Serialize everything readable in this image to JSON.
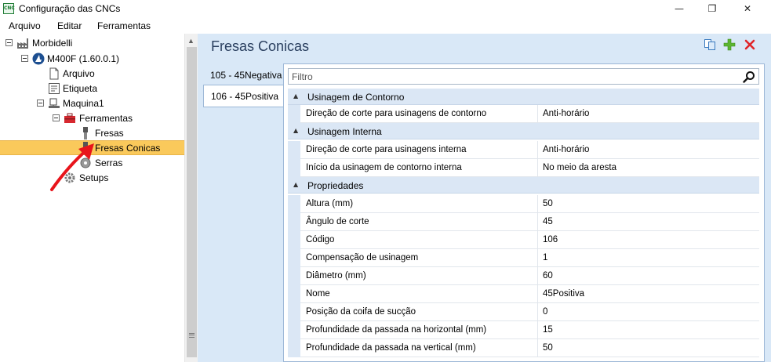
{
  "window": {
    "title": "Configuração das CNCs",
    "app_icon_text": "CNC",
    "minimize": "—",
    "maximize": "❐",
    "close": "✕"
  },
  "menu": {
    "items": [
      "Arquivo",
      "Editar",
      "Ferramentas"
    ]
  },
  "tree": {
    "items": [
      {
        "label": "Morbidelli",
        "icon": "factory-icon"
      },
      {
        "label": "M400F (1.60.0.1)",
        "icon": "machine-logo-icon"
      },
      {
        "label": "Arquivo",
        "icon": "document-icon"
      },
      {
        "label": "Etiqueta",
        "icon": "label-icon"
      },
      {
        "label": "Maquina1",
        "icon": "machine-icon"
      },
      {
        "label": "Ferramentas",
        "icon": "toolbox-icon"
      },
      {
        "label": "Fresas",
        "icon": "drill-bit-icon"
      },
      {
        "label": "Fresas Conicas",
        "icon": "conical-bit-icon",
        "selected": true
      },
      {
        "label": "Serras",
        "icon": "saw-icon"
      },
      {
        "label": "Setups",
        "icon": "gear-icon"
      }
    ]
  },
  "main": {
    "title": "Fresas Conicas",
    "toolbar": {
      "copy_icon": "copy-icon",
      "add_icon": "add-icon",
      "delete_icon": "delete-icon"
    },
    "tabs": [
      {
        "label": "105 - 45Negativa",
        "active": false
      },
      {
        "label": "106 - 45Positiva",
        "active": true
      }
    ],
    "filter": {
      "placeholder": "Filtro",
      "value": ""
    },
    "categories": [
      {
        "name": "Usinagem de Contorno",
        "rows": [
          {
            "name": "Direção de corte para usinagens de contorno",
            "value": "Anti-horário"
          }
        ]
      },
      {
        "name": "Usinagem Interna",
        "rows": [
          {
            "name": "Direção de corte para usinagens interna",
            "value": "Anti-horário"
          },
          {
            "name": "Início da usinagem de contorno interna",
            "value": "No meio da aresta"
          }
        ]
      },
      {
        "name": "Propriedades",
        "rows": [
          {
            "name": "Altura (mm)",
            "value": "50"
          },
          {
            "name": "Ângulo de corte",
            "value": "45"
          },
          {
            "name": "Código",
            "value": "106"
          },
          {
            "name": "Compensação de usinagem",
            "value": "1"
          },
          {
            "name": "Diâmetro (mm)",
            "value": "60"
          },
          {
            "name": "Nome",
            "value": "45Positiva"
          },
          {
            "name": "Posição da coifa de sucção",
            "value": "0"
          },
          {
            "name": "Profundidade da passada na horizontal (mm)",
            "value": "15"
          },
          {
            "name": "Profundidade da passada na vertical (mm)",
            "value": "50"
          }
        ]
      }
    ]
  },
  "colors": {
    "selection": "#fac95b",
    "panel_bg": "#d9e8f7",
    "category_bg": "#dbe7f5",
    "annotation_arrow": "#e8141b"
  }
}
